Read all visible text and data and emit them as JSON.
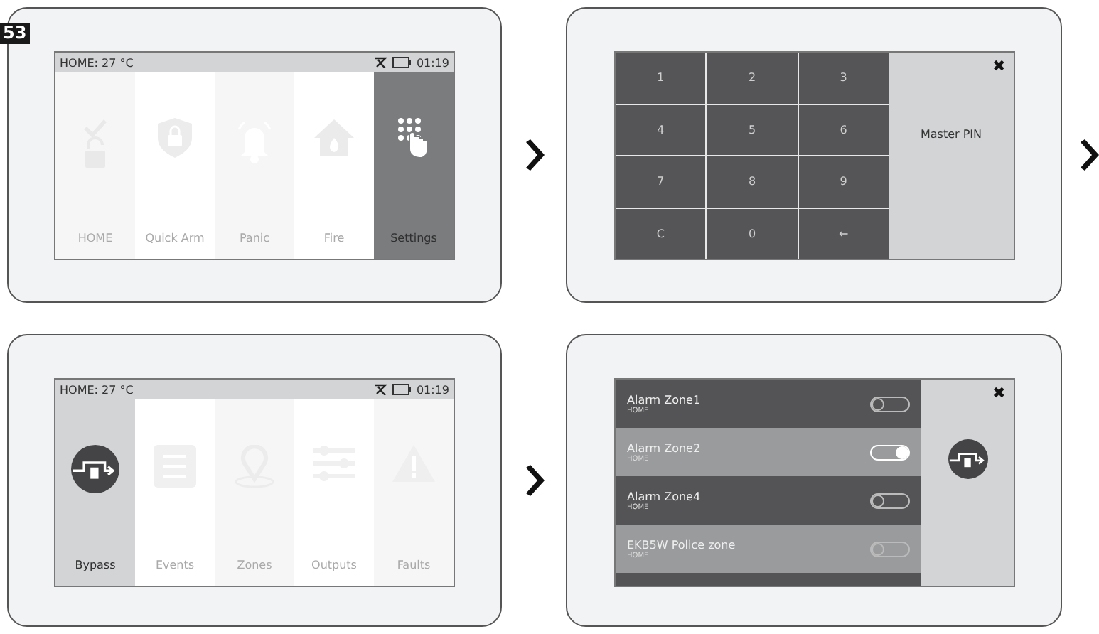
{
  "badge": "53",
  "screens": [
    {
      "kind": "menu",
      "status": {
        "location": "HOME: 27 °C",
        "time": "01:19"
      },
      "tiles": [
        {
          "kind": "home",
          "label": "HOME",
          "selected": false,
          "pressed": false
        },
        {
          "kind": "quick_arm",
          "label": "Quick Arm",
          "selected": false,
          "pressed": false
        },
        {
          "kind": "panic",
          "label": "Panic",
          "selected": false,
          "pressed": false
        },
        {
          "kind": "fire",
          "label": "Fire",
          "selected": false,
          "pressed": false
        },
        {
          "kind": "settings",
          "label": "Settings",
          "selected": true,
          "pressed": true
        }
      ]
    },
    {
      "kind": "keypad",
      "keys": [
        "1",
        "2",
        "3",
        "4",
        "5",
        "6",
        "7",
        "8",
        "9",
        "C",
        "0",
        "←"
      ],
      "close": "✖",
      "title": "Master PIN"
    },
    {
      "kind": "menu",
      "status": {
        "location": "HOME: 27 °C",
        "time": "01:19"
      },
      "tiles": [
        {
          "kind": "bypass",
          "label": "Bypass",
          "selected": true,
          "pressed": false
        },
        {
          "kind": "events",
          "label": "Events",
          "selected": false,
          "pressed": false
        },
        {
          "kind": "zones",
          "label": "Zones",
          "selected": false,
          "pressed": false
        },
        {
          "kind": "outputs",
          "label": "Outputs",
          "selected": false,
          "pressed": false
        },
        {
          "kind": "faults",
          "label": "Faults",
          "selected": false,
          "pressed": false
        }
      ]
    },
    {
      "kind": "zones",
      "close": "✖",
      "zones": [
        {
          "name": "Alarm Zone1",
          "area": "HOME",
          "on": false
        },
        {
          "name": "Alarm Zone2",
          "area": "HOME",
          "on": true
        },
        {
          "name": "Alarm Zone4",
          "area": "HOME",
          "on": false
        },
        {
          "name": "EKB5W Police zone",
          "area": "HOME",
          "on": false
        }
      ]
    }
  ]
}
